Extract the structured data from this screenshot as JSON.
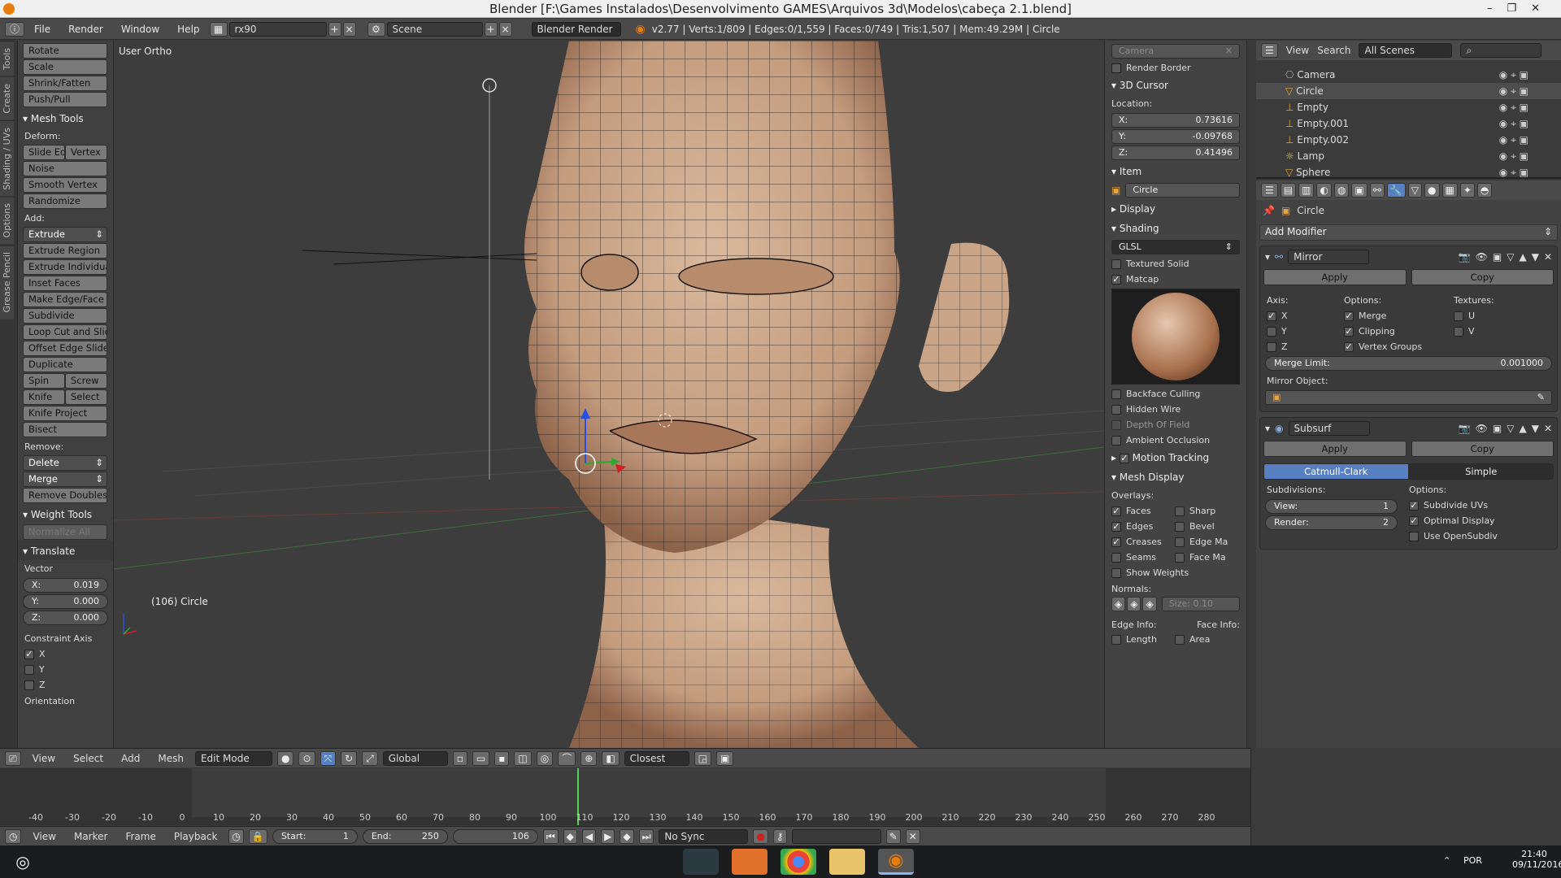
{
  "window": {
    "title": "Blender [F:\\Games Instalados\\Desenvolvimento GAMES\\Arquivos 3d\\Modelos\\cabeça 2.1.blend]"
  },
  "infobar": {
    "menus": [
      "File",
      "Render",
      "Window",
      "Help"
    ],
    "layout": "rx90",
    "scene": "Scene",
    "engine": "Blender Render",
    "stats": "v2.77 | Verts:1/809 | Edges:0/1,559 | Faces:0/749 | Tris:1,507 | Mem:49.29M | Circle"
  },
  "left_tabs": [
    "Tools",
    "Create",
    "Shading / UVs",
    "Options",
    "Grease Pencil"
  ],
  "toolshelf": {
    "top_buttons": [
      "Rotate",
      "Scale",
      "Shrink/Fatten",
      "Push/Pull"
    ],
    "mesh_tools_title": "Mesh Tools",
    "deform_label": "Deform:",
    "deform_row": [
      "Slide Ed",
      "Vertex"
    ],
    "deform_buttons": [
      "Noise",
      "Smooth Vertex",
      "Randomize"
    ],
    "add_label": "Add:",
    "extrude_select": "Extrude",
    "add_buttons": [
      "Extrude Region",
      "Extrude Individual",
      "Inset Faces",
      "Make Edge/Face",
      "Subdivide",
      "Loop Cut and Slide",
      "Offset Edge Slide",
      "Duplicate"
    ],
    "spin_row": [
      "Spin",
      "Screw"
    ],
    "knife_row": [
      "Knife",
      "Select"
    ],
    "more_buttons": [
      "Knife Project",
      "Bisect"
    ],
    "remove_label": "Remove:",
    "delete_select": "Delete",
    "merge_select": "Merge",
    "remove_doubles": "Remove Doubles",
    "weight_tools_title": "Weight Tools",
    "normalize_all": "Normalize All",
    "translate_title": "Translate",
    "vector_label": "Vector",
    "vector": [
      {
        "axis": "X:",
        "value": "0.019"
      },
      {
        "axis": "Y:",
        "value": "0.000"
      },
      {
        "axis": "Z:",
        "value": "0.000"
      }
    ],
    "constraint_axis_label": "Constraint Axis",
    "constraint_axes": [
      {
        "label": "X",
        "checked": true
      },
      {
        "label": "Y",
        "checked": false
      },
      {
        "label": "Z",
        "checked": false
      }
    ],
    "orientation_label": "Orientation"
  },
  "viewport": {
    "view_label": "User Ortho",
    "object_label": "(106) Circle"
  },
  "npanel": {
    "camera_field": "Camera",
    "render_border": "Render Border",
    "cursor_title": "3D Cursor",
    "location_label": "Location:",
    "cursor": [
      {
        "axis": "X:",
        "value": "0.73616"
      },
      {
        "axis": "Y:",
        "value": "-0.09768"
      },
      {
        "axis": "Z:",
        "value": "0.41496"
      }
    ],
    "item_title": "Item",
    "item_name": "Circle",
    "display_title": "Display",
    "shading_title": "Shading",
    "shading_mode": "GLSL",
    "textured_solid": "Textured Solid",
    "matcap": "Matcap",
    "backface_culling": "Backface Culling",
    "hidden_wire": "Hidden Wire",
    "depth_of_field": "Depth Of Field",
    "ambient_occlusion": "Ambient Occlusion",
    "motion_tracking": "Motion Tracking",
    "mesh_display_title": "Mesh Display",
    "overlays_label": "Overlays:",
    "overlays": [
      {
        "a": "Faces",
        "a_on": true,
        "b": "Sharp",
        "b_on": false
      },
      {
        "a": "Edges",
        "a_on": true,
        "b": "Bevel",
        "b_on": false
      },
      {
        "a": "Creases",
        "a_on": true,
        "b": "Edge Ma",
        "b_on": false
      },
      {
        "a": "Seams",
        "a_on": false,
        "b": "Face Ma",
        "b_on": false
      }
    ],
    "show_weights": "Show Weights",
    "normals_label": "Normals:",
    "normals_size": "Size:  0.10",
    "edge_info_label": "Edge Info:",
    "face_info_label": "Face Info:",
    "length": "Length",
    "area": "Area"
  },
  "outliner": {
    "menus": [
      "View",
      "Search"
    ],
    "scene_filter": "All Scenes",
    "items": [
      "Camera",
      "Circle",
      "Empty",
      "Empty.001",
      "Empty.002",
      "Lamp",
      "Sphere"
    ]
  },
  "properties": {
    "object_name": "Circle",
    "add_modifier": "Add Modifier",
    "mirror": {
      "name": "Mirror",
      "apply": "Apply",
      "copy": "Copy",
      "axis_label": "Axis:",
      "options_label": "Options:",
      "textures_label": "Textures:",
      "axes": [
        {
          "label": "X",
          "on": true
        },
        {
          "label": "Y",
          "on": false
        },
        {
          "label": "Z",
          "on": false
        }
      ],
      "options": [
        {
          "label": "Merge",
          "on": true
        },
        {
          "label": "Clipping",
          "on": true
        },
        {
          "label": "Vertex Groups",
          "on": true
        }
      ],
      "textures": [
        {
          "label": "U",
          "on": false
        },
        {
          "label": "V",
          "on": false
        }
      ],
      "merge_limit_label": "Merge Limit:",
      "merge_limit_value": "0.001000",
      "mirror_object_label": "Mirror Object:"
    },
    "subsurf": {
      "name": "Subsurf",
      "apply": "Apply",
      "copy": "Copy",
      "mode_catmull": "Catmull-Clark",
      "mode_simple": "Simple",
      "subdivisions_label": "Subdivisions:",
      "options_label": "Options:",
      "view_label": "View:",
      "view_value": "1",
      "render_label": "Render:",
      "render_value": "2",
      "options": [
        {
          "label": "Subdivide UVs",
          "on": true
        },
        {
          "label": "Optimal Display",
          "on": true
        },
        {
          "label": "Use OpenSubdiv",
          "on": false
        }
      ]
    }
  },
  "view3d_header": {
    "menus": [
      "View",
      "Select",
      "Add",
      "Mesh"
    ],
    "mode": "Edit Mode",
    "orientation": "Global",
    "snap": "Closest"
  },
  "timeline": {
    "ticks": [
      "-40",
      "-30",
      "-20",
      "-10",
      "0",
      "10",
      "20",
      "30",
      "40",
      "50",
      "60",
      "70",
      "80",
      "90",
      "100",
      "110",
      "120",
      "130",
      "140",
      "150",
      "160",
      "170",
      "180",
      "190",
      "200",
      "210",
      "220",
      "230",
      "240",
      "250",
      "260",
      "270",
      "280"
    ],
    "menus": [
      "View",
      "Marker",
      "Frame",
      "Playback"
    ],
    "start_label": "Start:",
    "start_value": "1",
    "end_label": "End:",
    "end_value": "250",
    "current_frame": "106",
    "sync": "No Sync"
  },
  "taskbar": {
    "lang": "POR",
    "time": "21:40",
    "date": "09/11/2016"
  },
  "colors": {
    "accent": "#e87d0d",
    "selected_blue": "#5680c2",
    "mesh_skin": "#c8a58a"
  }
}
